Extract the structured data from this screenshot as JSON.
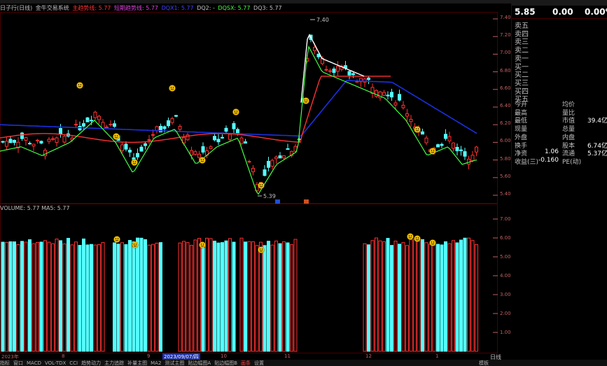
{
  "legend": {
    "title": "日子行(日线)",
    "system": "金牛交易系统",
    "items": [
      {
        "label": "主趋势线: 5.77",
        "color": "#ff3030"
      },
      {
        "label": "短期趋势线: 5.77",
        "color": "#e040e0"
      },
      {
        "label": "DQX1: 5.77",
        "color": "#4040ff"
      },
      {
        "label": "DQ2: -",
        "color": "#c0c0c0"
      },
      {
        "label": "DQSX: 5.77",
        "color": "#40ff40"
      },
      {
        "label": "DQ3: 5.77",
        "color": "#c0c0c0"
      }
    ]
  },
  "volume_legend": "VOLUME: 5.77  MA5: 5.77",
  "quote": {
    "price": "5.85",
    "change": "0.00",
    "pct": "0.00%"
  },
  "orderbook": [
    "卖五",
    "卖四",
    "卖三",
    "卖二",
    "卖一",
    "买一",
    "买二",
    "买三",
    "买四",
    "买五"
  ],
  "stats": [
    {
      "l1": "今开",
      "v1": "",
      "l2": "均价",
      "v2": ""
    },
    {
      "l1": "最高",
      "v1": "",
      "l2": "量比",
      "v2": ""
    },
    {
      "l1": "最低",
      "v1": "",
      "l2": "市值",
      "v2": "39.4亿"
    },
    {
      "l1": "现量",
      "v1": "",
      "l2": "总量",
      "v2": ""
    },
    {
      "l1": "外盘",
      "v1": "",
      "l2": "内盘",
      "v2": ""
    },
    {
      "l1": "换手",
      "v1": "",
      "l2": "股本",
      "v2": "6.74亿"
    },
    {
      "l1": "净资",
      "v1": "1.06",
      "l2": "流通",
      "v2": "5.37亿"
    },
    {
      "l1": "收益(三)",
      "v1": "-0.160",
      "l2": "PE(动)",
      "v2": ""
    }
  ],
  "price_axis": [
    "7.40",
    "7.20",
    "7.00",
    "6.80",
    "6.60",
    "6.40",
    "6.20",
    "6.00",
    "5.80",
    "5.60",
    "5.40"
  ],
  "volume_axis": [
    "7.00",
    "6.00",
    "5.00",
    "4.00",
    "3.00",
    "2.00",
    "1.00"
  ],
  "x_axis": [
    {
      "label": "2023年"
    },
    {
      "label": "8"
    },
    {
      "label": "9"
    },
    {
      "label": "10"
    },
    {
      "label": "11"
    },
    {
      "label": "12"
    },
    {
      "label": "1"
    }
  ],
  "date_badge": "2023/09/07/四",
  "day_button": "日线",
  "annotations": {
    "high": "7.40",
    "low": "5.39"
  },
  "tabs": [
    {
      "label": "指标",
      "active": false
    },
    {
      "label": "窗口",
      "active": false
    },
    {
      "label": "MACD",
      "active": false
    },
    {
      "label": "VOL-TDX",
      "active": false
    },
    {
      "label": "CCI",
      "active": false
    },
    {
      "label": "趋势动力",
      "active": false
    },
    {
      "label": "主力追踪",
      "active": false
    },
    {
      "label": "补量主图",
      "active": false
    },
    {
      "label": "MA2",
      "active": false
    },
    {
      "label": "测试主图",
      "active": false
    },
    {
      "label": "贴边幅图A",
      "active": false
    },
    {
      "label": "贴边幅图B",
      "active": false
    },
    {
      "label": "画条",
      "active": true
    },
    {
      "label": "设置",
      "active": false
    }
  ],
  "tab_right": "模板",
  "colors": {
    "up": "#ff3030",
    "down": "#54ffff",
    "grid": "#4a0000",
    "ma_long": "#1a30e0",
    "trend": "#ff3030"
  }
}
